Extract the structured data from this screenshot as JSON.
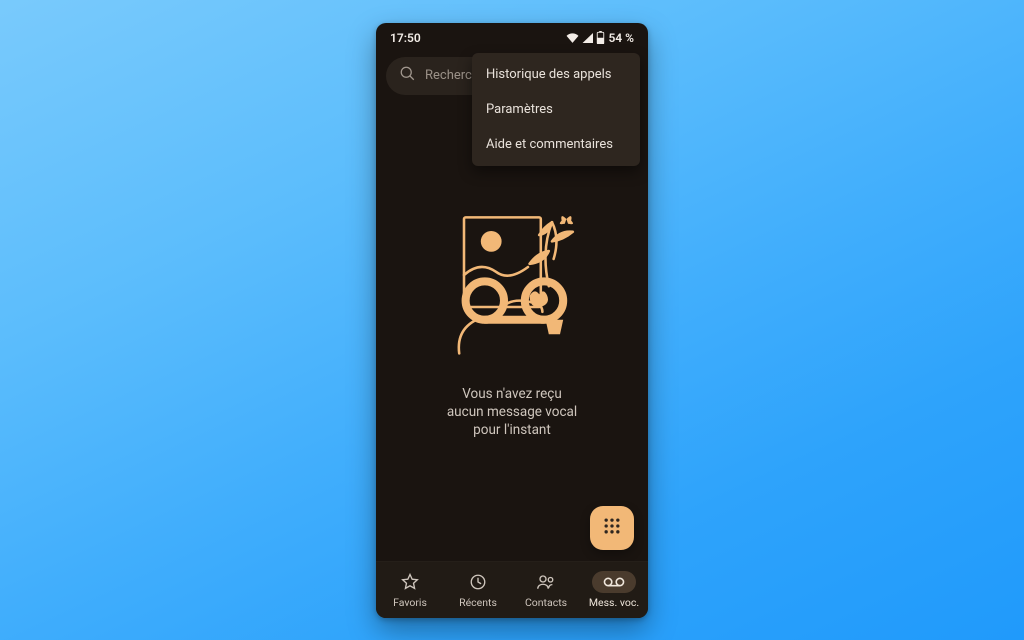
{
  "colors": {
    "accent": "#f2b877",
    "phone_bg": "#1a1410",
    "surface": "#2a231d",
    "menu_bg": "#2e261f",
    "text_muted": "#b7ada3"
  },
  "statusbar": {
    "time": "17:50",
    "battery_text": "54 %"
  },
  "search": {
    "placeholder": "Rechercher d"
  },
  "overflow_menu": {
    "items": [
      {
        "label": "Historique des appels"
      },
      {
        "label": "Paramètres"
      },
      {
        "label": "Aide et commentaires"
      }
    ]
  },
  "empty_state": {
    "line1": "Vous n'avez reçu",
    "line2": "aucun message vocal",
    "line3": "pour l'instant"
  },
  "nav": {
    "items": [
      {
        "label": "Favoris",
        "icon": "star-icon",
        "active": false
      },
      {
        "label": "Récents",
        "icon": "recents-icon",
        "active": false
      },
      {
        "label": "Contacts",
        "icon": "contacts-icon",
        "active": false
      },
      {
        "label": "Mess. voc.",
        "icon": "voicemail-icon",
        "active": true
      }
    ]
  }
}
